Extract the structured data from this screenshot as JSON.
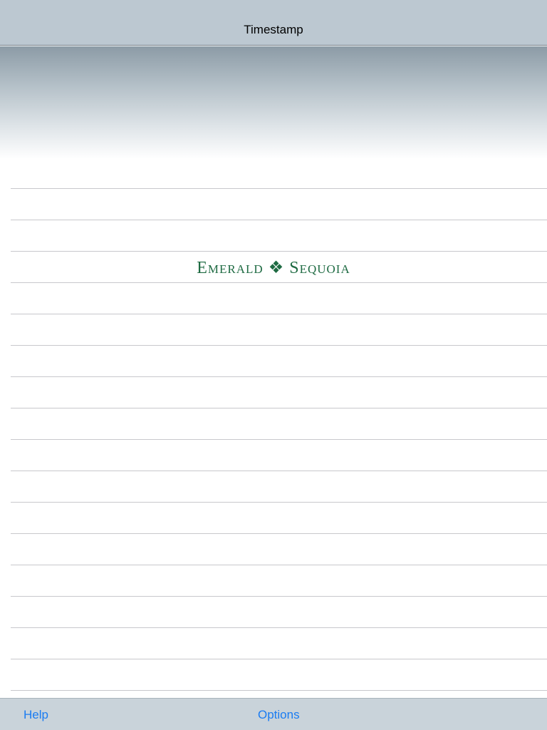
{
  "navbar": {
    "title": "Timestamp"
  },
  "brand": {
    "logo_text": "Emerald ❖ Sequoia",
    "color": "#1f6b43"
  },
  "toolbar": {
    "help_label": "Help",
    "options_label": "Options",
    "accent_color": "#1a7cf2"
  },
  "colors": {
    "navbar_bg": "#bcc8d1",
    "toolbar_bg": "#c9d3da",
    "separator": "#c8c8cc"
  }
}
